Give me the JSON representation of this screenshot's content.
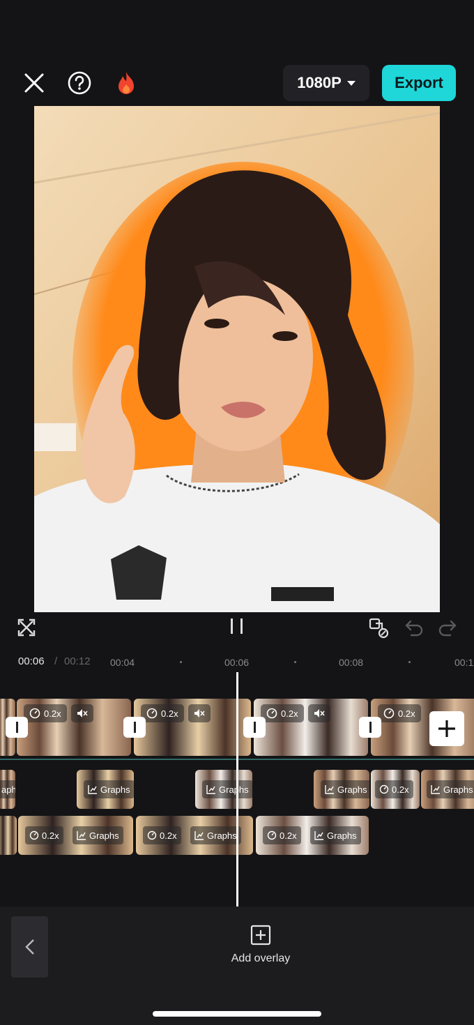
{
  "header": {
    "close_icon": "close-icon",
    "help_icon": "help-icon",
    "fire_icon": "fire-icon",
    "resolution_label": "1080P",
    "export_label": "Export",
    "accent_color": "#1fd6d9"
  },
  "player": {
    "fullscreen_icon": "fullscreen-icon",
    "pause_icon": "pause-icon",
    "keyframe_icon": "keyframe-icon",
    "undo_icon": "undo-icon",
    "redo_icon": "redo-icon"
  },
  "time": {
    "current": "00:06",
    "separator": "/",
    "total": "00:12",
    "ticks": [
      "00:04",
      "00:06",
      "00:08",
      "00:1"
    ]
  },
  "timeline": {
    "main_track": [
      {
        "speed": "0.2x"
      },
      {
        "speed": "0.2x"
      },
      {
        "speed": "0.2x"
      },
      {
        "speed": "0.2x"
      }
    ],
    "overlay_track_1": [
      {
        "label": "aphs"
      },
      {
        "label": "Graphs"
      },
      {
        "label": "Graphs"
      },
      {
        "label": "Graphs"
      },
      {
        "label": "0.2x"
      },
      {
        "label": "Graphs"
      }
    ],
    "overlay_track_2": [
      {
        "speed": "0.2x",
        "label": "Graphs"
      },
      {
        "speed": "0.2x",
        "label": "Graphs"
      },
      {
        "speed": "0.2x",
        "label": "Graphs"
      }
    ]
  },
  "bottom": {
    "back_icon": "chevron-left-icon",
    "add_overlay_label": "Add overlay"
  }
}
